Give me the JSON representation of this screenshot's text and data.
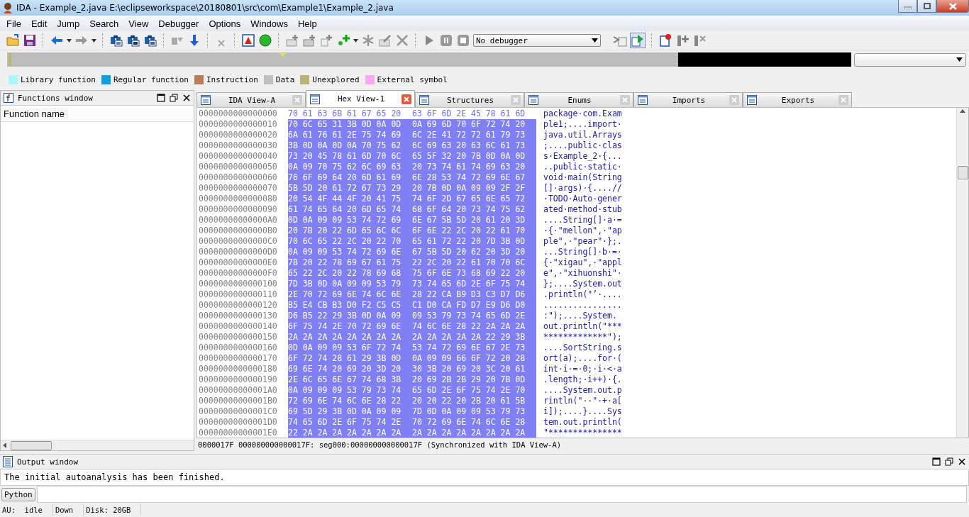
{
  "window": {
    "title": "IDA - Example_2.java E:\\eclipseworkspace\\20180801\\src\\com\\Example1\\Example_2.java"
  },
  "menu": [
    {
      "label": "File"
    },
    {
      "label": "Edit"
    },
    {
      "label": "Jump"
    },
    {
      "label": "Search"
    },
    {
      "label": "View"
    },
    {
      "label": "Debugger"
    },
    {
      "label": "Options"
    },
    {
      "label": "Windows"
    },
    {
      "label": "Help"
    }
  ],
  "toolbar": {
    "debugger_select": "No debugger"
  },
  "legend": [
    {
      "label": "Library function",
      "color": "#aaf6ff"
    },
    {
      "label": "Regular function",
      "color": "#10a0e0"
    },
    {
      "label": "Instruction",
      "color": "#b87c58"
    },
    {
      "label": "Data",
      "color": "#c0c0c0"
    },
    {
      "label": "Unexplored",
      "color": "#b8b478"
    },
    {
      "label": "External symbol",
      "color": "#ffa8f0"
    }
  ],
  "functions_window": {
    "title": "Functions window",
    "column": "Function name"
  },
  "tabs": [
    {
      "label": "IDA View-A",
      "selected": false
    },
    {
      "label": "Hex View-1",
      "selected": true
    },
    {
      "label": "Structures",
      "selected": false
    },
    {
      "label": "Enums",
      "selected": false
    },
    {
      "label": "Imports",
      "selected": false
    },
    {
      "label": "Exports",
      "selected": false
    }
  ],
  "hex_view": {
    "rows": [
      {
        "address": "0000000000000000",
        "group_1": "70 61 63 6B 61 67 65 20",
        "group_2": "63 6F 6D 2E 45 78 61 6D",
        "ascii": "package·com.Exam",
        "selected": false
      },
      {
        "address": "0000000000000010",
        "group_1": "70 6C 65 31 3B 0D 0A 0D",
        "group_2": "0A 69 6D 70 6F 72 74 20",
        "ascii": "ple1;....import·",
        "selected": true
      },
      {
        "address": "0000000000000020",
        "group_1": "6A 61 76 61 2E 75 74 69",
        "group_2": "6C 2E 41 72 72 61 79 73",
        "ascii": "java.util.Arrays",
        "selected": true
      },
      {
        "address": "0000000000000030",
        "group_1": "3B 0D 0A 0D 0A 70 75 62",
        "group_2": "6C 69 63 20 63 6C 61 73",
        "ascii": ";....public·clas",
        "selected": true
      },
      {
        "address": "0000000000000040",
        "group_1": "73 20 45 78 61 6D 70 6C",
        "group_2": "65 5F 32 20 7B 0D 0A 0D",
        "ascii": "s·Example_2·{...",
        "selected": true
      },
      {
        "address": "0000000000000050",
        "group_1": "0A 09 70 75 62 6C 69 63",
        "group_2": "20 73 74 61 74 69 63 20",
        "ascii": "..public·static·",
        "selected": true
      },
      {
        "address": "0000000000000060",
        "group_1": "76 6F 69 64 20 6D 61 69",
        "group_2": "6E 28 53 74 72 69 6E 67",
        "ascii": "void·main(String",
        "selected": true
      },
      {
        "address": "0000000000000070",
        "group_1": "5B 5D 20 61 72 67 73 29",
        "group_2": "20 7B 0D 0A 09 09 2F 2F",
        "ascii": "[]·args)·{....//",
        "selected": true
      },
      {
        "address": "0000000000000080",
        "group_1": "20 54 4F 44 4F 20 41 75",
        "group_2": "74 6F 2D 67 65 6E 65 72",
        "ascii": "·TODO·Auto-gener",
        "selected": true
      },
      {
        "address": "0000000000000090",
        "group_1": "61 74 65 64 20 6D 65 74",
        "group_2": "68 6F 64 20 73 74 75 62",
        "ascii": "ated·method·stub",
        "selected": true
      },
      {
        "address": "00000000000000A0",
        "group_1": "0D 0A 09 09 53 74 72 69",
        "group_2": "6E 67 5B 5D 20 61 20 3D",
        "ascii": "....String[]·a·=",
        "selected": true
      },
      {
        "address": "00000000000000B0",
        "group_1": "20 7B 20 22 6D 65 6C 6C",
        "group_2": "6F 6E 22 2C 20 22 61 70",
        "ascii": "·{·\"mellon\",·\"ap",
        "selected": true
      },
      {
        "address": "00000000000000C0",
        "group_1": "70 6C 65 22 2C 20 22 70",
        "group_2": "65 61 72 22 20 7D 3B 0D",
        "ascii": "ple\",·\"pear\"·};.",
        "selected": true
      },
      {
        "address": "00000000000000D0",
        "group_1": "0A 09 09 53 74 72 69 6E",
        "group_2": "67 5B 5D 20 62 20 3D 20",
        "ascii": "...String[]·b·=·",
        "selected": true
      },
      {
        "address": "00000000000000E0",
        "group_1": "7B 20 22 78 69 67 61 75",
        "group_2": "22 2C 20 22 61 70 70 6C",
        "ascii": "{·\"xigau\",·\"appl",
        "selected": true
      },
      {
        "address": "00000000000000F0",
        "group_1": "65 22 2C 20 22 78 69 68",
        "group_2": "75 6F 6E 73 68 69 22 20",
        "ascii": "e\",·\"xihuonshi\"·",
        "selected": true
      },
      {
        "address": "0000000000000100",
        "group_1": "7D 3B 0D 0A 09 09 53 79",
        "group_2": "73 74 65 6D 2E 6F 75 74",
        "ascii": "};....System.out",
        "selected": true
      },
      {
        "address": "0000000000000110",
        "group_1": "2E 70 72 69 6E 74 6C 6E",
        "group_2": "28 22 CA B9 D3 C3 D7 D6",
        "ascii": ".println(\"’·....",
        "selected": true
      },
      {
        "address": "0000000000000120",
        "group_1": "B5 E4 CB B3 D0 F2 C5 C5",
        "group_2": "C1 D0 CA FD D7 E9 D6 D0",
        "ascii": "................",
        "selected": true
      },
      {
        "address": "0000000000000130",
        "group_1": "D6 B5 22 29 3B 0D 0A 09",
        "group_2": "09 53 79 73 74 65 6D 2E",
        "ascii": ":\");....System.",
        "selected": true
      },
      {
        "address": "0000000000000140",
        "group_1": "6F 75 74 2E 70 72 69 6E",
        "group_2": "74 6C 6E 28 22 2A 2A 2A",
        "ascii": "out.println(\"***",
        "selected": true
      },
      {
        "address": "0000000000000150",
        "group_1": "2A 2A 2A 2A 2A 2A 2A 2A",
        "group_2": "2A 2A 2A 2A 2A 22 29 3B",
        "ascii": "*************\");",
        "selected": true
      },
      {
        "address": "0000000000000160",
        "group_1": "0D 0A 09 09 53 6F 72 74",
        "group_2": "53 74 72 69 6E 67 2E 73",
        "ascii": "....SortString.s",
        "selected": true
      },
      {
        "address": "0000000000000170",
        "group_1": "6F 72 74 28 61 29 3B 0D",
        "group_2": "0A 09 09 66 6F 72 20 28",
        "ascii": "ort(a);....for·(",
        "selected": true
      },
      {
        "address": "0000000000000180",
        "group_1": "69 6E 74 20 69 20 3D 20",
        "group_2": "30 3B 20 69 20 3C 20 61",
        "ascii": "int·i·=·0;·i·<·a",
        "selected": true
      },
      {
        "address": "0000000000000190",
        "group_1": "2E 6C 65 6E 67 74 68 3B",
        "group_2": "20 69 2B 2B 29 20 7B 0D",
        "ascii": ".length;·i++)·{.",
        "selected": true
      },
      {
        "address": "00000000000001A0",
        "group_1": "0A 09 09 09 53 79 73 74",
        "group_2": "65 6D 2E 6F 75 74 2E 70",
        "ascii": "....System.out.p",
        "selected": true
      },
      {
        "address": "00000000000001B0",
        "group_1": "72 69 6E 74 6C 6E 28 22",
        "group_2": "20 20 22 20 2B 20 61 5B",
        "ascii": "rintln(\"··\"·+·a[",
        "selected": true
      },
      {
        "address": "00000000000001C0",
        "group_1": "69 5D 29 3B 0D 0A 09 09",
        "group_2": "7D 0D 0A 09 09 53 79 73",
        "ascii": "i]);....}....Sys",
        "selected": true
      },
      {
        "address": "00000000000001D0",
        "group_1": "74 65 6D 2E 6F 75 74 2E",
        "group_2": "70 72 69 6E 74 6C 6E 28",
        "ascii": "tem.out.println(",
        "selected": true
      },
      {
        "address": "00000000000001E0",
        "group_1": "22 2A 2A 2A 2A 2A 2A 2A",
        "group_2": "2A 2A 2A 2A 2A 2A 2A 2A",
        "ascii": "\"***************",
        "selected": true
      }
    ],
    "status": "0000017F 000000000000017F: seg000:000000000000017F (Synchronized with IDA View-A)"
  },
  "output_window": {
    "title": "Output window",
    "lines": [
      "The initial autoanalysis has been finished."
    ],
    "python_button": "Python"
  },
  "status_bar": [
    "AU:  idle",
    "Down",
    "Disk: 20GB"
  ]
}
